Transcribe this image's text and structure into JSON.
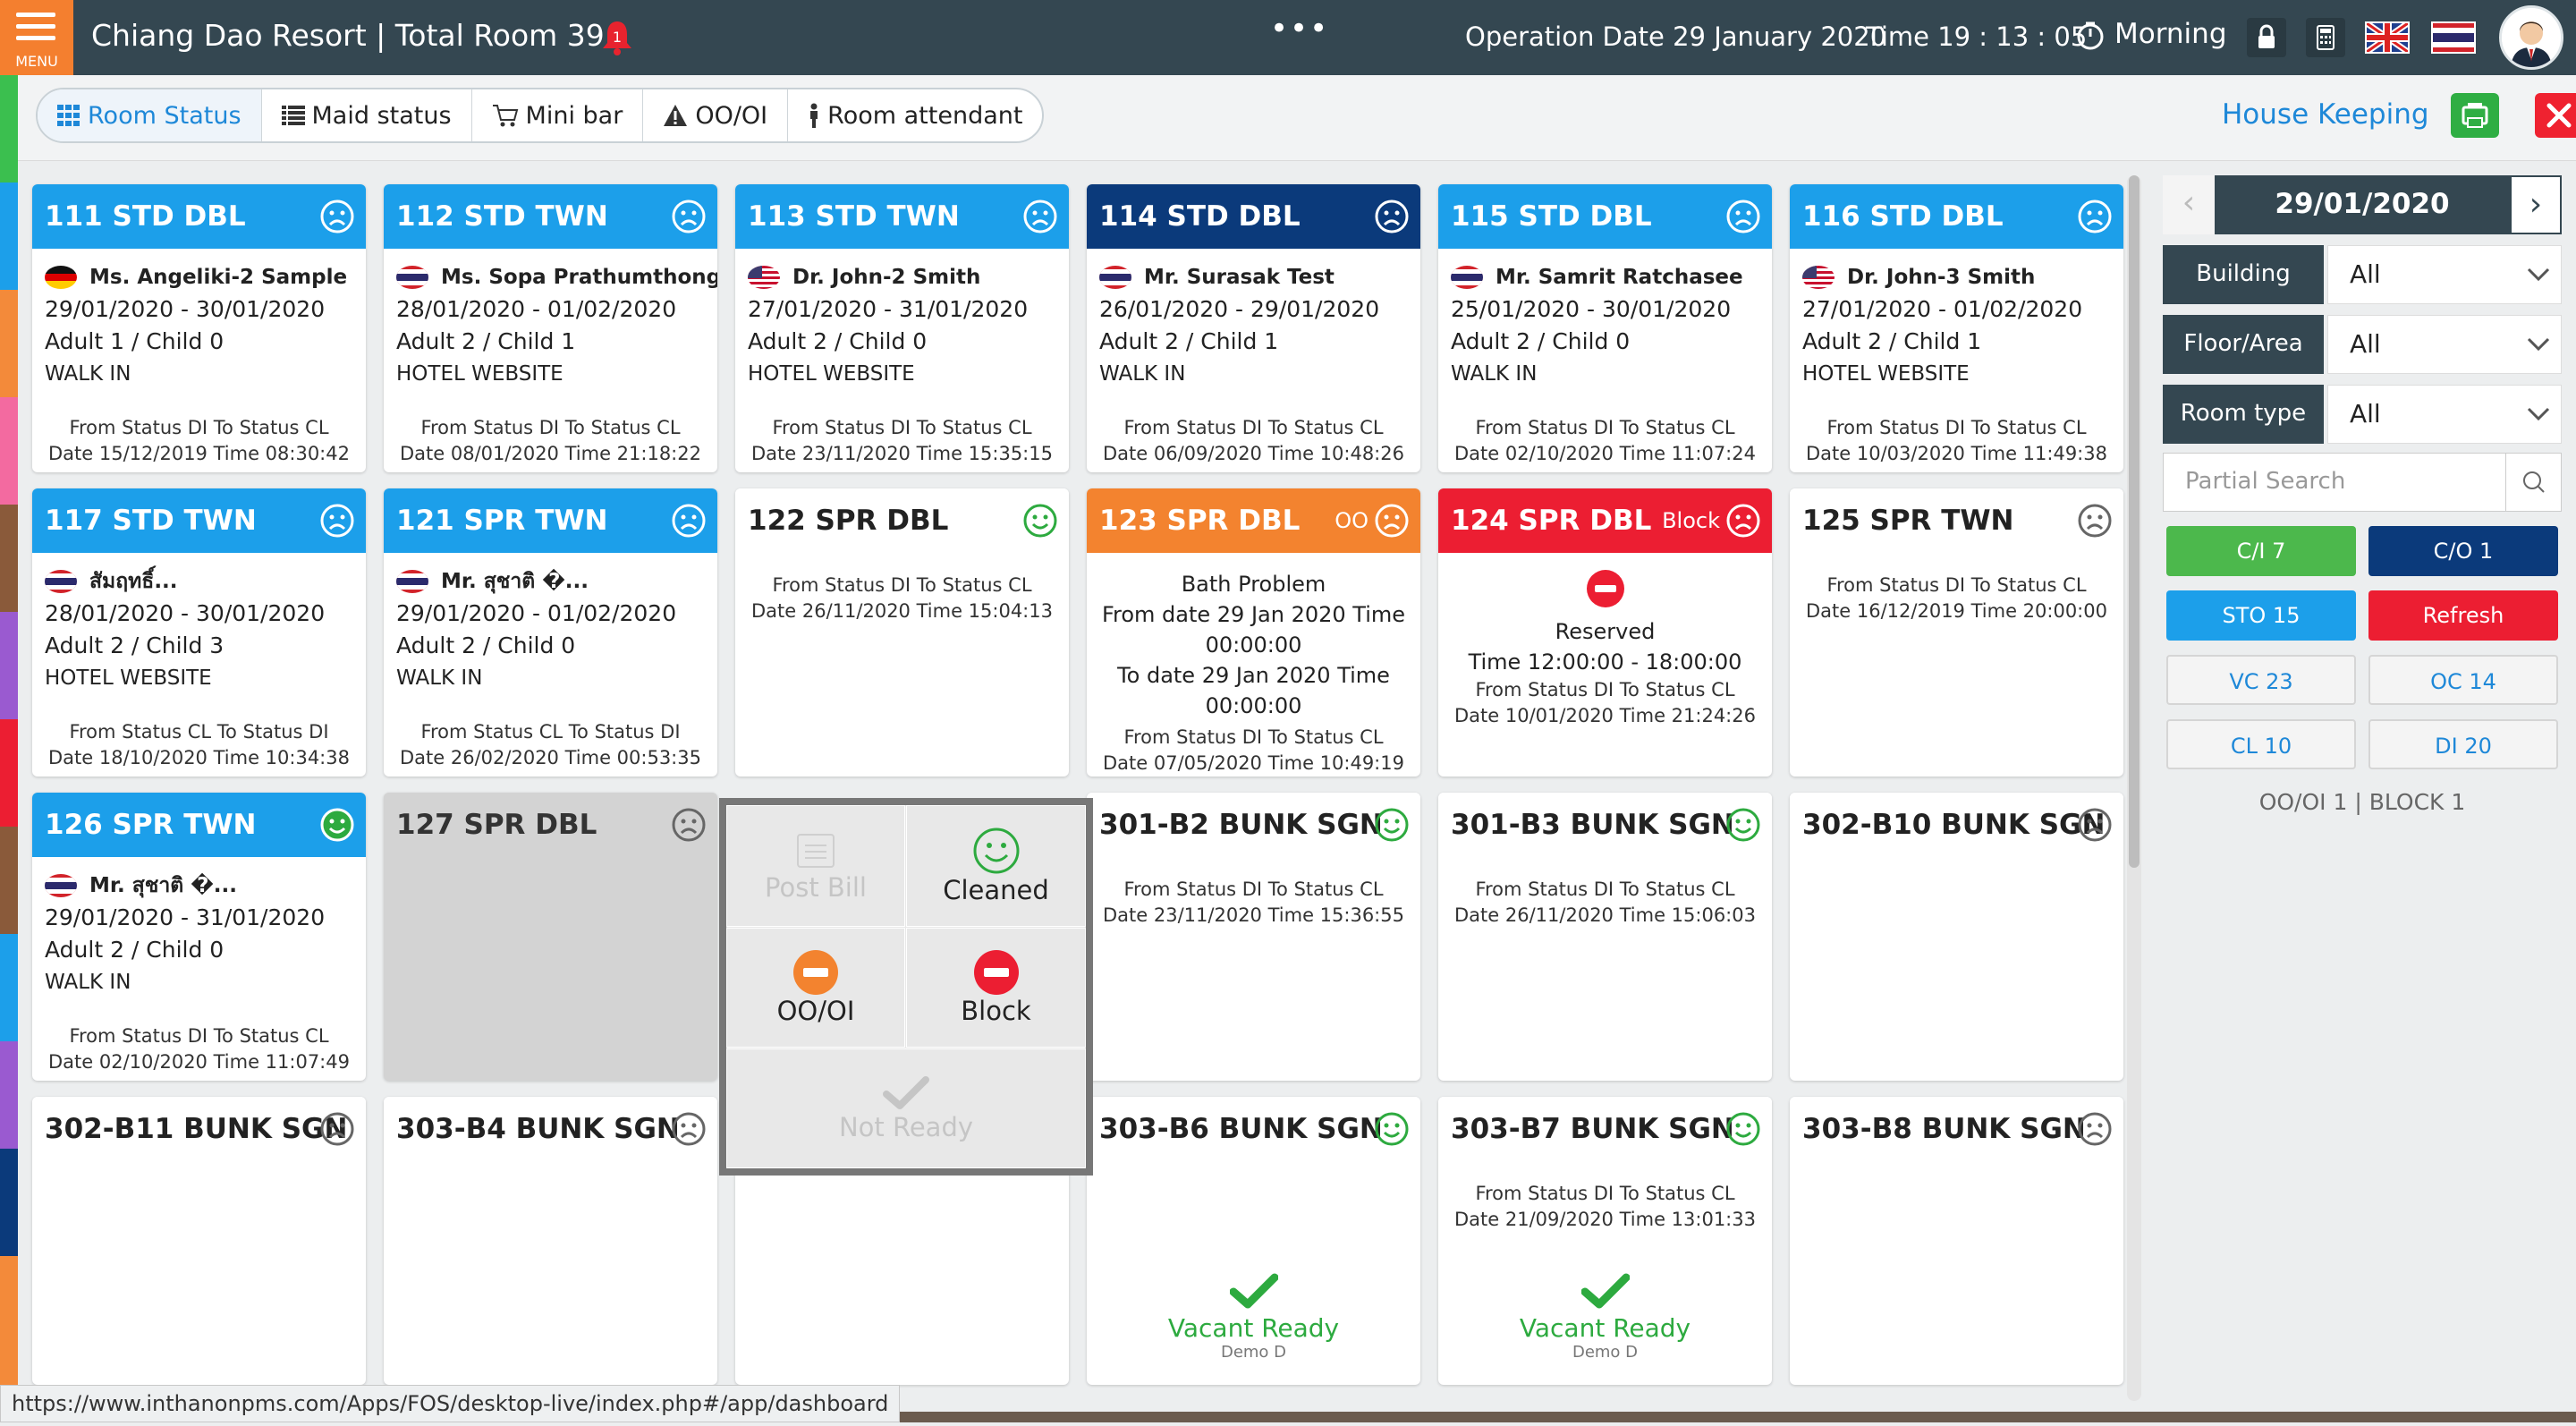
{
  "header": {
    "menu_label": "MENU",
    "title": "Chiang Dao Resort | Total Room 39",
    "notification_count": "1",
    "more": "•••",
    "operation_date": "Operation Date 29 January 2020",
    "time": "Time  19 : 13 : 05",
    "shift": "Morning"
  },
  "tabs": [
    {
      "label": "Room Status"
    },
    {
      "label": "Maid status"
    },
    {
      "label": "Mini bar"
    },
    {
      "label": "OO/OI"
    },
    {
      "label": "Room attendant"
    }
  ],
  "module_title": "House Keeping",
  "rooms": [
    {
      "title": "111 STD DBL",
      "guest": "Ms. Angeliki-2 Sample",
      "flag": "de",
      "dates": "29/01/2020 - 30/01/2020",
      "pax": "Adult 1 / Child 0",
      "source": "WALK IN",
      "from": "From Status DI To Status CL",
      "date": "Date 15/12/2019 Time 08:30:42"
    },
    {
      "title": "112 STD TWN",
      "guest": "Ms. Sopa Prathumthong",
      "flag": "th",
      "dates": "28/01/2020 - 01/02/2020",
      "pax": "Adult 2 / Child 1",
      "source": "HOTEL WEBSITE",
      "from": "From Status DI To Status CL",
      "date": "Date 08/01/2020 Time 21:18:22"
    },
    {
      "title": "113 STD TWN",
      "guest": "Dr. John-2 Smith",
      "flag": "us",
      "dates": "27/01/2020 - 31/01/2020",
      "pax": "Adult 2 / Child 0",
      "source": "HOTEL WEBSITE",
      "from": "From Status DI To Status CL",
      "date": "Date 23/11/2020 Time 15:35:15"
    },
    {
      "title": "114 STD DBL",
      "guest": "Mr. Surasak Test",
      "flag": "th",
      "dates": "26/01/2020 - 29/01/2020",
      "pax": "Adult 2 / Child 1",
      "source": "WALK IN",
      "from": "From Status DI To Status CL",
      "date": "Date 06/09/2020 Time 10:48:26"
    },
    {
      "title": "115 STD DBL",
      "guest": "Mr. Samrit Ratchasee",
      "flag": "th",
      "dates": "25/01/2020 - 30/01/2020",
      "pax": "Adult 2 / Child 0",
      "source": "WALK IN",
      "from": "From Status DI To Status CL",
      "date": "Date 02/10/2020 Time 11:07:24"
    },
    {
      "title": "116 STD DBL",
      "guest": "Dr. John-3 Smith",
      "flag": "us",
      "dates": "27/01/2020 - 01/02/2020",
      "pax": "Adult 2 / Child 1",
      "source": "HOTEL WEBSITE",
      "from": "From Status DI To Status CL",
      "date": "Date 10/03/2020 Time 11:49:38"
    },
    {
      "title": "117 STD TWN",
      "guest": "สัมฤทธิ์...",
      "flag": "th",
      "dates": "28/01/2020 - 30/01/2020",
      "pax": "Adult 2 / Child 3",
      "source": "HOTEL WEBSITE",
      "from": "From Status CL To Status DI",
      "date": "Date 18/10/2020 Time 10:34:38"
    },
    {
      "title": "121 SPR TWN",
      "guest": "Mr. สุชาติ �...",
      "flag": "th",
      "dates": "29/01/2020 - 01/02/2020",
      "pax": "Adult 2 / Child 0",
      "source": "WALK IN",
      "from": "From Status CL To Status DI",
      "date": "Date 26/02/2020 Time 00:53:35"
    },
    {
      "title": "122 SPR DBL",
      "from": "From Status DI To Status CL",
      "date": "Date 26/11/2020 Time 15:04:13"
    },
    {
      "title": "123 SPR DBL",
      "tag": "OO",
      "note": [
        "Bath Problem",
        "From date 29 Jan 2020 Time",
        "00:00:00",
        "To date 29 Jan 2020 Time",
        "00:00:00"
      ],
      "from": "From Status DI To Status CL",
      "date": "Date 07/05/2020 Time 10:49:19"
    },
    {
      "title": "124 SPR DBL",
      "tag": "Block",
      "reserved": "Reserved",
      "time_range": "Time 12:00:00 - 18:00:00",
      "from": "From Status DI To Status CL",
      "date": "Date 10/01/2020 Time 21:24:26"
    },
    {
      "title": "125 SPR TWN",
      "from": "From Status DI To Status CL",
      "date": "Date 16/12/2019 Time 20:00:00"
    },
    {
      "title": "126 SPR TWN",
      "guest": "Mr. สุชาติ �...",
      "flag": "th",
      "dates": "29/01/2020 - 31/01/2020",
      "pax": "Adult 2 / Child 0",
      "source": "WALK IN",
      "from": "From Status DI To Status CL",
      "date": "Date 02/10/2020 Time 11:07:49"
    },
    {
      "title": "127 SPR DBL"
    },
    {
      "title": "301-B2 BUNK SGN",
      "from": "From Status DI To Status CL",
      "date": "Date 23/11/2020 Time 15:36:55"
    },
    {
      "title": "301-B3 BUNK SGN",
      "from": "From Status DI To Status CL",
      "date": "Date 26/11/2020 Time 15:06:03"
    },
    {
      "title": "302-B10 BUNK SGN"
    },
    {
      "title": "302-B11 BUNK SGN"
    },
    {
      "title": "303-B4 BUNK SGN"
    },
    {
      "title": "303-B6 BUNK SGN",
      "vacant": "Vacant Ready",
      "vacant_sub": "Demo D"
    },
    {
      "title": "303-B7 BUNK SGN",
      "from": "From Status DI To Status CL",
      "date": "Date 21/09/2020 Time 13:01:33",
      "vacant": "Vacant Ready",
      "vacant_sub": "Demo D"
    },
    {
      "title": "303-B8 BUNK SGN"
    }
  ],
  "popup": {
    "post_bill": "Post Bill",
    "cleaned": "Cleaned",
    "oooi": "OO/OI",
    "block": "Block",
    "not_ready": "Not Ready"
  },
  "sidebar": {
    "date": "29/01/2020",
    "building_label": "Building",
    "building_value": "All",
    "floor_label": "Floor/Area",
    "floor_value": "All",
    "roomtype_label": "Room type",
    "roomtype_value": "All",
    "search_placeholder": "Partial Search",
    "ci": "C/I 7",
    "co": "C/O 1",
    "sto": "STO 15",
    "refresh": "Refresh",
    "vc": "VC 23",
    "oc": "OC 14",
    "cl": "CL 10",
    "di": "DI 20",
    "oooi_summary": "OO/OI 1 | BLOCK 1"
  },
  "colors": {
    "header_bg": "#344751",
    "menu_orange": "#f47f2f",
    "occupied_blue": "#1c9fea",
    "due_out_navy": "#0b3a7b",
    "oooi_orange": "#f3832f",
    "block_red": "#ec1e32",
    "ready_green": "#2daa3f",
    "accent_blue": "#1e88d8"
  },
  "status_url": "https://www.inthanonpms.com/Apps/FOS/desktop-live/index.php#/app/dashboard"
}
